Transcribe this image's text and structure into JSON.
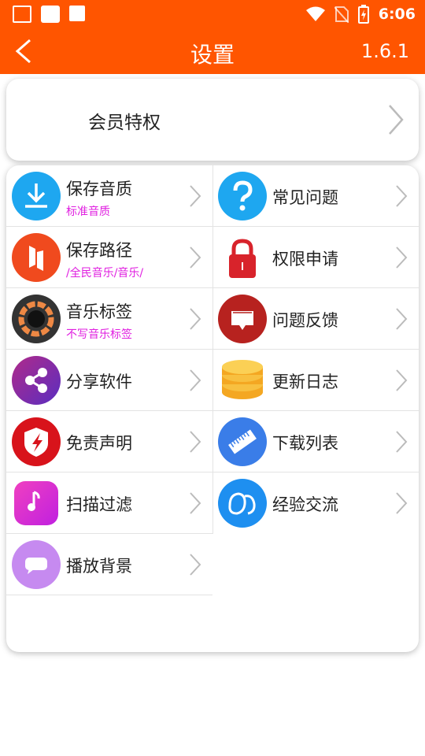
{
  "status_bar": {
    "time": "6:06"
  },
  "app_bar": {
    "title": "设置",
    "version": "1.6.1"
  },
  "vip": {
    "label": "会员特权"
  },
  "items_left": [
    {
      "label": "保存音质",
      "sub": "标准音质",
      "icon": "download-icon",
      "color": "#1ea7f0"
    },
    {
      "label": "保存路径",
      "sub": "/全民音乐/音乐/",
      "icon": "folder-path-icon",
      "color": "#f04a1e"
    },
    {
      "label": "音乐标签",
      "sub": "不写音乐标签",
      "icon": "music-tag-icon",
      "color": "#333333"
    },
    {
      "label": "分享软件",
      "sub": "",
      "icon": "share-icon",
      "color": "#8a2eb0"
    },
    {
      "label": "免责声明",
      "sub": "",
      "icon": "shield-icon",
      "color": "#d8131b"
    },
    {
      "label": "扫描过滤",
      "sub": "",
      "icon": "scan-filter-icon",
      "color": "#e82fd0"
    },
    {
      "label": "播放背景",
      "sub": "",
      "icon": "chat-bubble-icon",
      "color": "#c68af0"
    }
  ],
  "items_right": [
    {
      "label": "常见问题",
      "icon": "question-icon",
      "color": "#1ea7f0"
    },
    {
      "label": "权限申请",
      "icon": "lock-icon",
      "color": "#d8232b"
    },
    {
      "label": "问题反馈",
      "icon": "feedback-icon",
      "color": "#b7221f"
    },
    {
      "label": "更新日志",
      "icon": "coin-stack-icon",
      "color": "#f4a722"
    },
    {
      "label": "下载列表",
      "icon": "ruler-icon",
      "color": "#3a7de8"
    },
    {
      "label": "经验交流",
      "icon": "qq-icon",
      "color": "#1e8ff0"
    }
  ]
}
